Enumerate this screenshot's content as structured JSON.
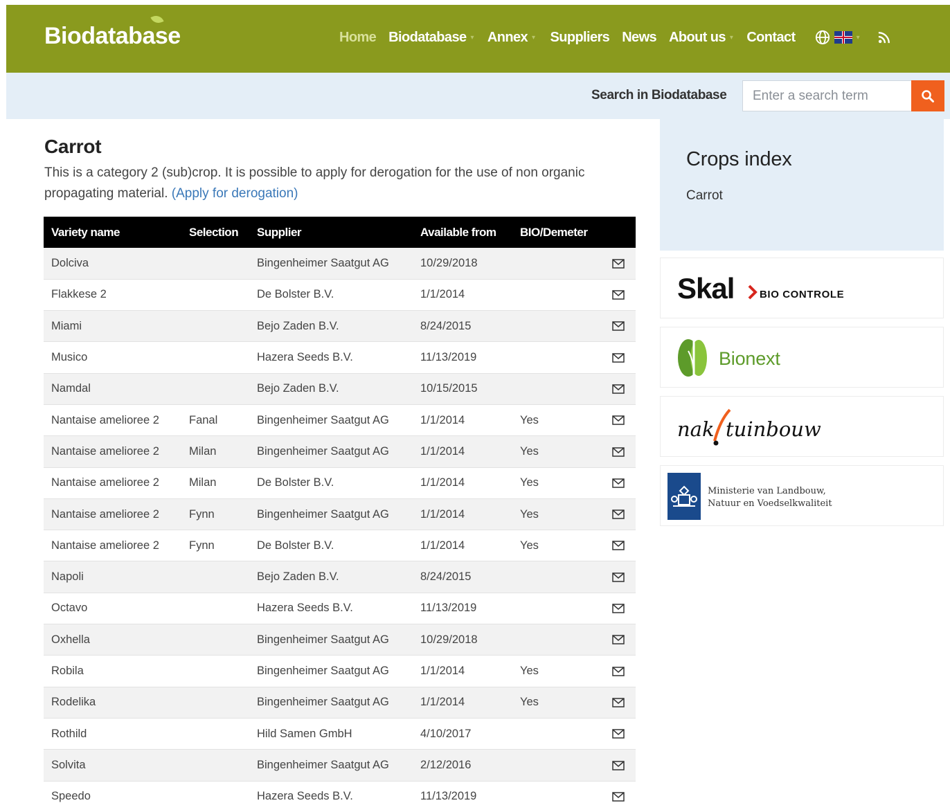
{
  "header": {
    "logo_text": "Biodatabase",
    "nav": [
      {
        "label": "Home",
        "has_dropdown": false
      },
      {
        "label": "Biodatabase",
        "has_dropdown": true
      },
      {
        "label": "Annex",
        "has_dropdown": true
      },
      {
        "label": "Suppliers",
        "has_dropdown": false
      },
      {
        "label": "News",
        "has_dropdown": false
      },
      {
        "label": "About us",
        "has_dropdown": true
      },
      {
        "label": "Contact",
        "has_dropdown": false
      }
    ],
    "icons": [
      "globe-icon",
      "uk-flag-icon",
      "rss-icon"
    ],
    "colors": {
      "bar": "#8a9a1e",
      "active_link": "#d8e09a"
    }
  },
  "search": {
    "label": "Search in Biodatabase",
    "placeholder": "Enter a search term",
    "button_color": "#f0601e"
  },
  "page": {
    "title": "Carrot",
    "intro_text": "This is a category 2 (sub)crop. It is possible to apply for derogation for the use of non organic propagating material.",
    "derogation_link": "(Apply for derogation)"
  },
  "table": {
    "headers": [
      "Variety name",
      "Selection",
      "Supplier",
      "Available from",
      "BIO/Demeter"
    ],
    "rows": [
      {
        "variety": "Dolciva",
        "selection": "",
        "supplier": "Bingenheimer Saatgut AG",
        "available": "10/29/2018",
        "bio": ""
      },
      {
        "variety": "Flakkese 2",
        "selection": "",
        "supplier": "De Bolster B.V.",
        "available": "1/1/2014",
        "bio": ""
      },
      {
        "variety": "Miami",
        "selection": "",
        "supplier": "Bejo Zaden B.V.",
        "available": "8/24/2015",
        "bio": ""
      },
      {
        "variety": "Musico",
        "selection": "",
        "supplier": "Hazera Seeds B.V.",
        "available": "11/13/2019",
        "bio": ""
      },
      {
        "variety": "Namdal",
        "selection": "",
        "supplier": "Bejo Zaden B.V.",
        "available": "10/15/2015",
        "bio": ""
      },
      {
        "variety": "Nantaise amelioree 2",
        "selection": "Fanal",
        "supplier": "Bingenheimer Saatgut AG",
        "available": "1/1/2014",
        "bio": "Yes"
      },
      {
        "variety": "Nantaise amelioree 2",
        "selection": "Milan",
        "supplier": "Bingenheimer Saatgut AG",
        "available": "1/1/2014",
        "bio": "Yes"
      },
      {
        "variety": "Nantaise amelioree 2",
        "selection": "Milan",
        "supplier": "De Bolster B.V.",
        "available": "1/1/2014",
        "bio": "Yes"
      },
      {
        "variety": "Nantaise amelioree 2",
        "selection": "Fynn",
        "supplier": "Bingenheimer Saatgut AG",
        "available": "1/1/2014",
        "bio": "Yes"
      },
      {
        "variety": "Nantaise amelioree 2",
        "selection": "Fynn",
        "supplier": "De Bolster B.V.",
        "available": "1/1/2014",
        "bio": "Yes"
      },
      {
        "variety": "Napoli",
        "selection": "",
        "supplier": "Bejo Zaden B.V.",
        "available": "8/24/2015",
        "bio": ""
      },
      {
        "variety": "Octavo",
        "selection": "",
        "supplier": "Hazera Seeds B.V.",
        "available": "11/13/2019",
        "bio": ""
      },
      {
        "variety": "Oxhella",
        "selection": "",
        "supplier": "Bingenheimer Saatgut AG",
        "available": "10/29/2018",
        "bio": ""
      },
      {
        "variety": "Robila",
        "selection": "",
        "supplier": "Bingenheimer Saatgut AG",
        "available": "1/1/2014",
        "bio": "Yes"
      },
      {
        "variety": "Rodelika",
        "selection": "",
        "supplier": "Bingenheimer Saatgut AG",
        "available": "1/1/2014",
        "bio": "Yes"
      },
      {
        "variety": "Rothild",
        "selection": "",
        "supplier": "Hild Samen GmbH",
        "available": "4/10/2017",
        "bio": ""
      },
      {
        "variety": "Solvita",
        "selection": "",
        "supplier": "Bingenheimer Saatgut AG",
        "available": "2/12/2016",
        "bio": ""
      },
      {
        "variety": "Speedo",
        "selection": "",
        "supplier": "Hazera Seeds B.V.",
        "available": "11/13/2019",
        "bio": ""
      }
    ],
    "row_icon": "mail-icon"
  },
  "sidebar": {
    "crops_title": "Crops index",
    "crops_items": [
      "Carrot"
    ],
    "partners": [
      {
        "name": "skal-logo",
        "text_main": "Skal",
        "text_sub": "BIO CONTROLE"
      },
      {
        "name": "bionext-logo",
        "text_main": "Bionext"
      },
      {
        "name": "naktuinbouw-logo",
        "text_left": "nak",
        "text_right": "tuinbouw"
      },
      {
        "name": "ministerie-logo",
        "line1": "Ministerie van Landbouw,",
        "line2": "Natuur en Voedselkwaliteit"
      }
    ]
  }
}
